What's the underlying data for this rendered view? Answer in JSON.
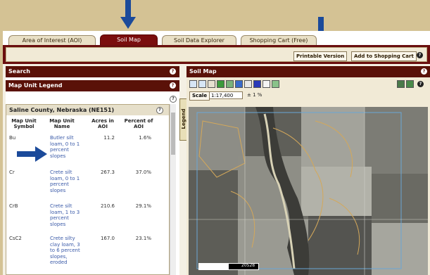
{
  "tabs": [
    {
      "label": "Area of Interest (AOI)",
      "active": false
    },
    {
      "label": "Soil Map",
      "active": true
    },
    {
      "label": "Soil Data Explorer",
      "active": false
    },
    {
      "label": "Shopping Cart (Free)",
      "active": false
    }
  ],
  "toolbar": {
    "printable_label": "Printable Version",
    "add_cart_label": "Add to Shopping Cart",
    "help_glyph": "?"
  },
  "left_panel": {
    "search_title": "Search",
    "legend_title": "Map Unit Legend",
    "help_glyph": "?"
  },
  "legend": {
    "county": "Saline County, Nebraska (NE151)",
    "columns": [
      "Map Unit Symbol",
      "Map Unit Name",
      "Acres in AOI",
      "Percent of AOI"
    ],
    "rows": [
      {
        "symbol": "Bu",
        "name": "Butler silt loam, 0 to 1 percent slopes",
        "acres": "11.2",
        "percent": "1.6%"
      },
      {
        "symbol": "Cr",
        "name": "Crete silt loam, 0 to 1 percent slopes",
        "acres": "267.3",
        "percent": "37.0%"
      },
      {
        "symbol": "CrB",
        "name": "Crete silt loam, 1 to 3 percent slopes",
        "acres": "210.6",
        "percent": "29.1%"
      },
      {
        "symbol": "CsC2",
        "name": "Crete silty clay loam, 3 to 6 percent slopes, eroded",
        "acres": "167.0",
        "percent": "23.1%"
      }
    ]
  },
  "legend_tab": "Legend",
  "map_panel": {
    "title": "Soil Map",
    "scale_label": "Scale",
    "scale_value": "1:17,400",
    "scale_accuracy": "± 1 %",
    "scale_bar_value": "20528"
  },
  "colors": {
    "accent_dark": "#6a0e0e",
    "panel_header": "#5a1108",
    "arrow": "#1b4a9a",
    "background": "#d4c294"
  }
}
